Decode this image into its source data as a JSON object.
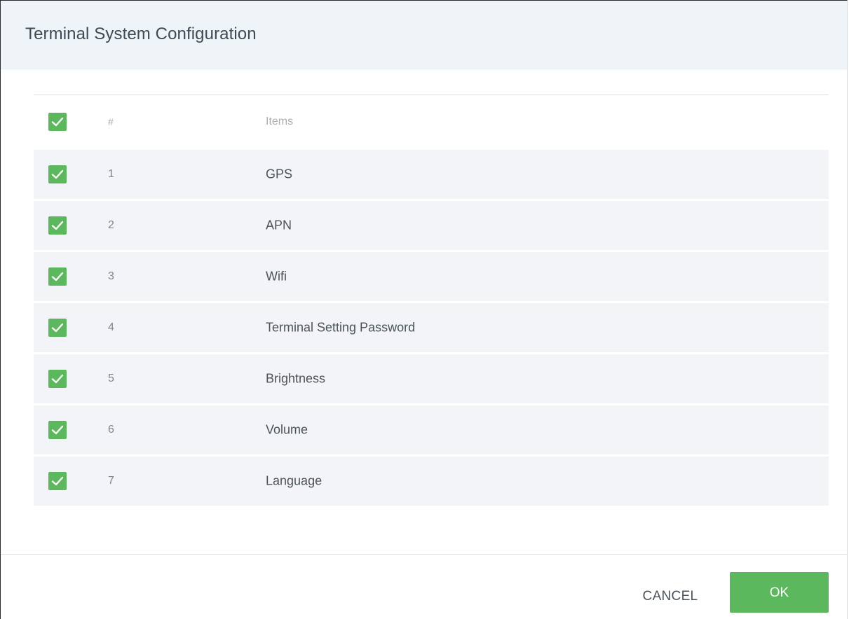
{
  "dialog": {
    "title": "Terminal System Configuration"
  },
  "table": {
    "header": {
      "checked": true,
      "num_label": "#",
      "items_label": "Items"
    },
    "rows": [
      {
        "num": "1",
        "label": "GPS",
        "checked": true
      },
      {
        "num": "2",
        "label": "APN",
        "checked": true
      },
      {
        "num": "3",
        "label": "Wifi",
        "checked": true
      },
      {
        "num": "4",
        "label": "Terminal Setting Password",
        "checked": true
      },
      {
        "num": "5",
        "label": "Brightness",
        "checked": true
      },
      {
        "num": "6",
        "label": "Volume",
        "checked": true
      },
      {
        "num": "7",
        "label": "Language",
        "checked": true
      }
    ]
  },
  "footer": {
    "cancel_label": "CANCEL",
    "ok_label": "OK"
  },
  "colors": {
    "accent_green": "#5cb85c",
    "header_bg": "#eef4f7",
    "row_bg": "#f2f4f7"
  },
  "icons": {
    "checkbox": "check-icon"
  }
}
